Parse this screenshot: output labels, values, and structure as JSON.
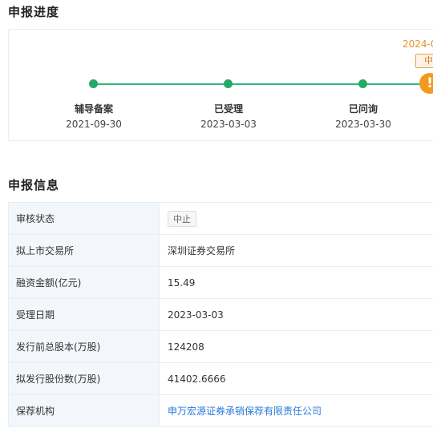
{
  "progress": {
    "title": "申报进度",
    "steps": [
      {
        "label": "辅导备案",
        "date": "2021-09-30"
      },
      {
        "label": "已受理",
        "date": "2023-03-03"
      },
      {
        "label": "已问询",
        "date": "2023-03-30"
      }
    ],
    "current": {
      "date": "2024-0",
      "badge": "中止",
      "icon": "exclamation-icon"
    }
  },
  "info": {
    "title": "申报信息",
    "rows": [
      {
        "label": "审核状态",
        "value": "中止"
      },
      {
        "label": "拟上市交易所",
        "value": "深圳证券交易所"
      },
      {
        "label": "融资金额(亿元)",
        "value": "15.49"
      },
      {
        "label": "受理日期",
        "value": "2023-03-03"
      },
      {
        "label": "发行前总股本(万股)",
        "value": "124208"
      },
      {
        "label": "拟发行股份数(万股)",
        "value": "41402.6666"
      },
      {
        "label": "保荐机构",
        "value": "申万宏源证券承销保荐有限责任公司"
      }
    ]
  },
  "colors": {
    "progress_green": "#22aa66",
    "warning_orange": "#f39a1e",
    "link_blue": "#2a7ad8",
    "label_bg": "#f3f7fb"
  }
}
